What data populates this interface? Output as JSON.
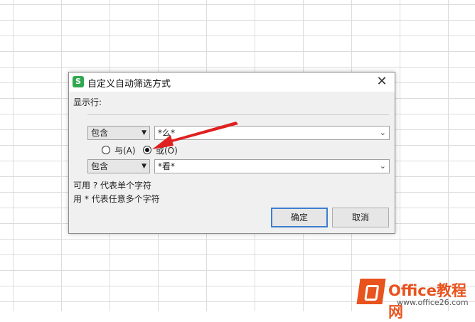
{
  "dialog": {
    "app_icon": "S",
    "title": "自定义自动筛选方式",
    "close_glyph": "✕",
    "show_rows_label": "显示行:",
    "row1": {
      "operator": "包含",
      "value": "*么*"
    },
    "row2": {
      "operator": "包含",
      "value": "*看*"
    },
    "radio_and": "与(A)",
    "radio_or": "或(O)",
    "selected_logic": "or",
    "hint1": "可用 ? 代表单个字符",
    "hint2": "用 * 代表任意多个字符",
    "ok_label": "确定",
    "cancel_label": "取消"
  },
  "watermark": {
    "brand": "Office教程网",
    "url": "www.office26.com"
  },
  "colors": {
    "accent_arrow": "#e02020",
    "brand_orange": "#e8531e",
    "primary_button_border": "#3c7fcf"
  }
}
